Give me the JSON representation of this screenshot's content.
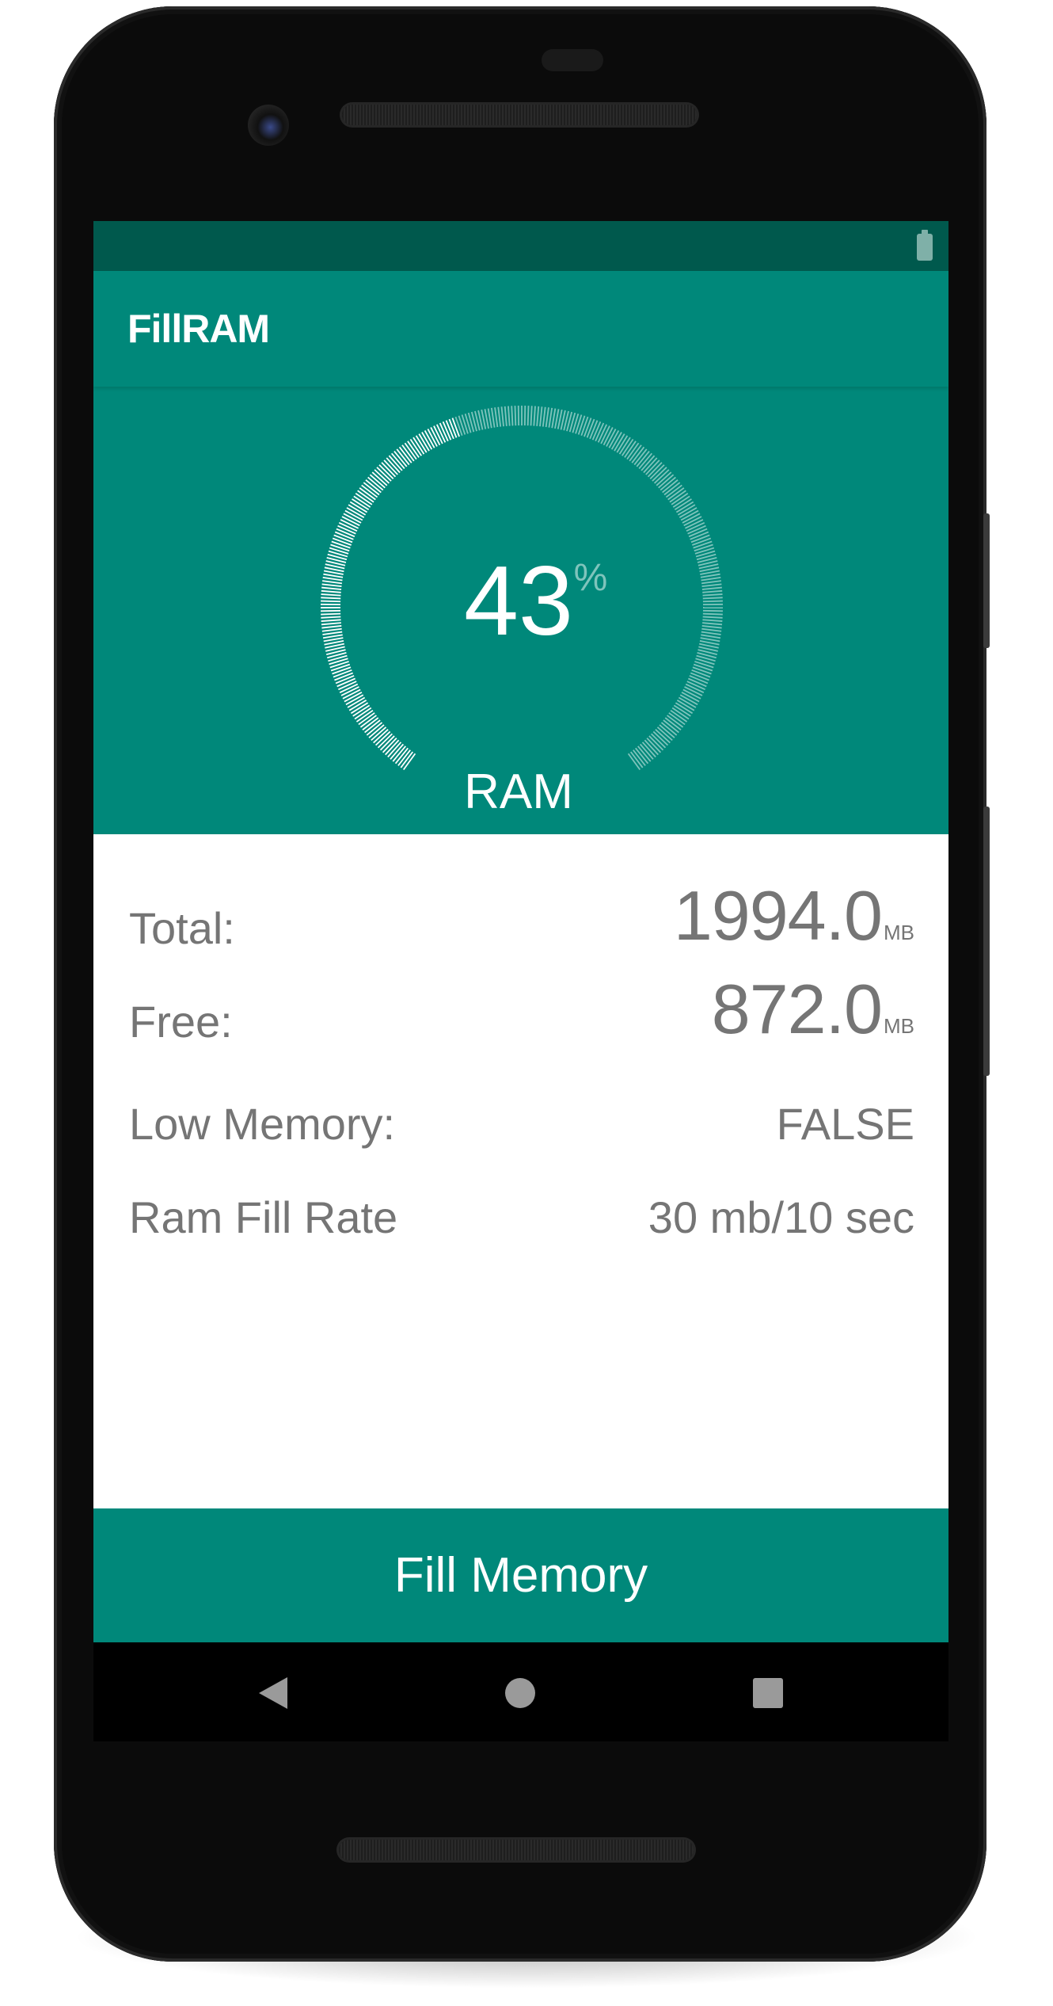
{
  "app": {
    "title": "FillRAM"
  },
  "status_bar": {
    "battery_icon": "battery-icon"
  },
  "gauge": {
    "percent": 43,
    "percent_text": "43",
    "percent_sign": "%",
    "label": "RAM",
    "fill_color": "#ffffff",
    "track_color": "#7fc4bc"
  },
  "info": {
    "rows": [
      {
        "label": "Total:",
        "value": "1994.0",
        "unit": "MB"
      },
      {
        "label": "Free:",
        "value": "872.0",
        "unit": "MB"
      },
      {
        "label": "Low Memory:",
        "value": "FALSE"
      },
      {
        "label": "Ram Fill Rate",
        "value": "30 mb/10 sec"
      }
    ]
  },
  "action": {
    "fill_label": "Fill Memory"
  },
  "nav": {
    "back_icon": "back-icon",
    "home_icon": "home-icon",
    "recents_icon": "recents-icon"
  },
  "colors": {
    "primary": "#00887a",
    "primary_dark": "#00594d",
    "text_secondary": "#757575"
  }
}
